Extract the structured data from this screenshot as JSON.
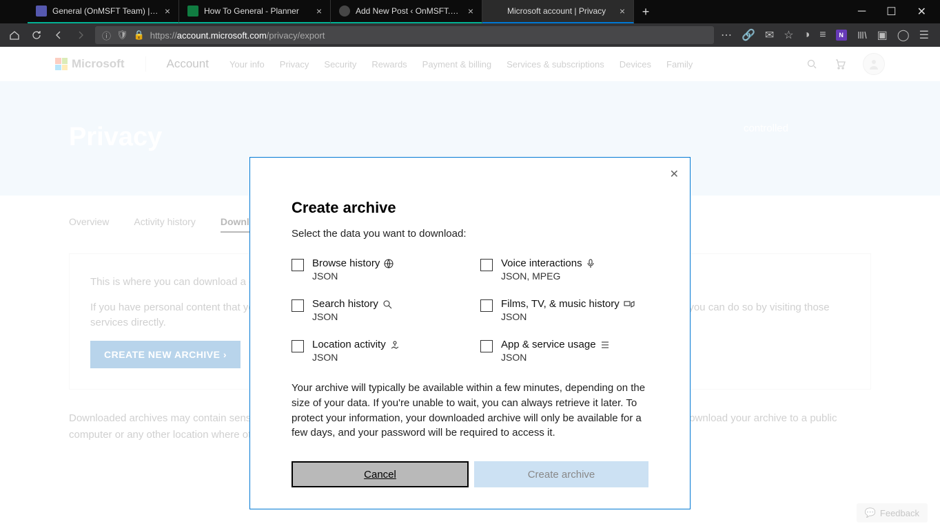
{
  "browser": {
    "tabs": [
      {
        "label": "General (OnMSFT Team) | Micr"
      },
      {
        "label": "How To General - Planner"
      },
      {
        "label": "Add New Post ‹ OnMSFT.com — W"
      },
      {
        "label": "Microsoft account | Privacy"
      }
    ],
    "url_host": "account.microsoft.com",
    "url_prefix": "https://",
    "url_path": "/privacy/export"
  },
  "header": {
    "logo": "Microsoft",
    "account": "Account",
    "links": [
      "Your info",
      "Privacy",
      "Security",
      "Rewards",
      "Payment & billing",
      "Services & subscriptions",
      "Devices",
      "Family"
    ]
  },
  "hero": {
    "title": "Privacy",
    "tagline": "controlled"
  },
  "page_tabs": [
    "Overview",
    "Activity history",
    "Download your data"
  ],
  "content": {
    "p1": "This is where you can download a copy of the data on your privacy dashboard. To learn more, see the Activity history page.",
    "p2": "If you have personal content that you'd like to download from other Microsoft services – such as your email, calendar and photos – you can do so by visiting those services directly.",
    "cta": "CREATE NEW ARCHIVE  ›",
    "note": "Downloaded archives may contain sensitive content, such as your search history, location information and other personal data. Do not download your archive to a public computer or any other location where others might be able to access it."
  },
  "feedback": "Feedback",
  "dialog": {
    "title": "Create archive",
    "sub": "Select the data you want to download:",
    "options": [
      {
        "label": "Browse history",
        "fmt": "JSON",
        "icon": "globe"
      },
      {
        "label": "Voice interactions",
        "fmt": "JSON, MPEG",
        "icon": "mic"
      },
      {
        "label": "Search history",
        "fmt": "JSON",
        "icon": "search"
      },
      {
        "label": "Films, TV, & music history",
        "fmt": "JSON",
        "icon": "media"
      },
      {
        "label": "Location activity",
        "fmt": "JSON",
        "icon": "map"
      },
      {
        "label": "App & service usage",
        "fmt": "JSON",
        "icon": "list"
      }
    ],
    "desc": "Your archive will typically be available within a few minutes, depending on the size of your data. If you're unable to wait, you can always retrieve it later. To protect your information, your downloaded archive will only be available for a few days, and your password will be required to access it.",
    "cancel": "Cancel",
    "create": "Create archive"
  }
}
